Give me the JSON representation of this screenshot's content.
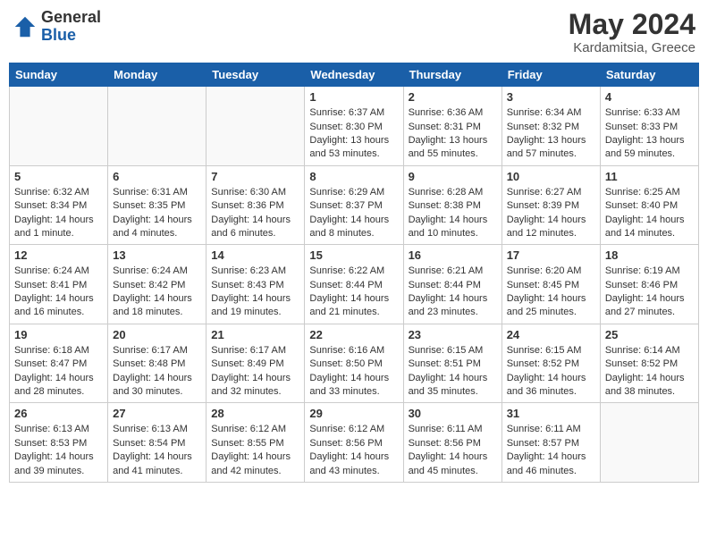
{
  "header": {
    "logo_general": "General",
    "logo_blue": "Blue",
    "title": "May 2024",
    "subtitle": "Kardamitsia, Greece"
  },
  "calendar": {
    "days_of_week": [
      "Sunday",
      "Monday",
      "Tuesday",
      "Wednesday",
      "Thursday",
      "Friday",
      "Saturday"
    ],
    "weeks": [
      [
        {
          "day": "",
          "info": ""
        },
        {
          "day": "",
          "info": ""
        },
        {
          "day": "",
          "info": ""
        },
        {
          "day": "1",
          "info": "Sunrise: 6:37 AM\nSunset: 8:30 PM\nDaylight: 13 hours\nand 53 minutes."
        },
        {
          "day": "2",
          "info": "Sunrise: 6:36 AM\nSunset: 8:31 PM\nDaylight: 13 hours\nand 55 minutes."
        },
        {
          "day": "3",
          "info": "Sunrise: 6:34 AM\nSunset: 8:32 PM\nDaylight: 13 hours\nand 57 minutes."
        },
        {
          "day": "4",
          "info": "Sunrise: 6:33 AM\nSunset: 8:33 PM\nDaylight: 13 hours\nand 59 minutes."
        }
      ],
      [
        {
          "day": "5",
          "info": "Sunrise: 6:32 AM\nSunset: 8:34 PM\nDaylight: 14 hours\nand 1 minute."
        },
        {
          "day": "6",
          "info": "Sunrise: 6:31 AM\nSunset: 8:35 PM\nDaylight: 14 hours\nand 4 minutes."
        },
        {
          "day": "7",
          "info": "Sunrise: 6:30 AM\nSunset: 8:36 PM\nDaylight: 14 hours\nand 6 minutes."
        },
        {
          "day": "8",
          "info": "Sunrise: 6:29 AM\nSunset: 8:37 PM\nDaylight: 14 hours\nand 8 minutes."
        },
        {
          "day": "9",
          "info": "Sunrise: 6:28 AM\nSunset: 8:38 PM\nDaylight: 14 hours\nand 10 minutes."
        },
        {
          "day": "10",
          "info": "Sunrise: 6:27 AM\nSunset: 8:39 PM\nDaylight: 14 hours\nand 12 minutes."
        },
        {
          "day": "11",
          "info": "Sunrise: 6:25 AM\nSunset: 8:40 PM\nDaylight: 14 hours\nand 14 minutes."
        }
      ],
      [
        {
          "day": "12",
          "info": "Sunrise: 6:24 AM\nSunset: 8:41 PM\nDaylight: 14 hours\nand 16 minutes."
        },
        {
          "day": "13",
          "info": "Sunrise: 6:24 AM\nSunset: 8:42 PM\nDaylight: 14 hours\nand 18 minutes."
        },
        {
          "day": "14",
          "info": "Sunrise: 6:23 AM\nSunset: 8:43 PM\nDaylight: 14 hours\nand 19 minutes."
        },
        {
          "day": "15",
          "info": "Sunrise: 6:22 AM\nSunset: 8:44 PM\nDaylight: 14 hours\nand 21 minutes."
        },
        {
          "day": "16",
          "info": "Sunrise: 6:21 AM\nSunset: 8:44 PM\nDaylight: 14 hours\nand 23 minutes."
        },
        {
          "day": "17",
          "info": "Sunrise: 6:20 AM\nSunset: 8:45 PM\nDaylight: 14 hours\nand 25 minutes."
        },
        {
          "day": "18",
          "info": "Sunrise: 6:19 AM\nSunset: 8:46 PM\nDaylight: 14 hours\nand 27 minutes."
        }
      ],
      [
        {
          "day": "19",
          "info": "Sunrise: 6:18 AM\nSunset: 8:47 PM\nDaylight: 14 hours\nand 28 minutes."
        },
        {
          "day": "20",
          "info": "Sunrise: 6:17 AM\nSunset: 8:48 PM\nDaylight: 14 hours\nand 30 minutes."
        },
        {
          "day": "21",
          "info": "Sunrise: 6:17 AM\nSunset: 8:49 PM\nDaylight: 14 hours\nand 32 minutes."
        },
        {
          "day": "22",
          "info": "Sunrise: 6:16 AM\nSunset: 8:50 PM\nDaylight: 14 hours\nand 33 minutes."
        },
        {
          "day": "23",
          "info": "Sunrise: 6:15 AM\nSunset: 8:51 PM\nDaylight: 14 hours\nand 35 minutes."
        },
        {
          "day": "24",
          "info": "Sunrise: 6:15 AM\nSunset: 8:52 PM\nDaylight: 14 hours\nand 36 minutes."
        },
        {
          "day": "25",
          "info": "Sunrise: 6:14 AM\nSunset: 8:52 PM\nDaylight: 14 hours\nand 38 minutes."
        }
      ],
      [
        {
          "day": "26",
          "info": "Sunrise: 6:13 AM\nSunset: 8:53 PM\nDaylight: 14 hours\nand 39 minutes."
        },
        {
          "day": "27",
          "info": "Sunrise: 6:13 AM\nSunset: 8:54 PM\nDaylight: 14 hours\nand 41 minutes."
        },
        {
          "day": "28",
          "info": "Sunrise: 6:12 AM\nSunset: 8:55 PM\nDaylight: 14 hours\nand 42 minutes."
        },
        {
          "day": "29",
          "info": "Sunrise: 6:12 AM\nSunset: 8:56 PM\nDaylight: 14 hours\nand 43 minutes."
        },
        {
          "day": "30",
          "info": "Sunrise: 6:11 AM\nSunset: 8:56 PM\nDaylight: 14 hours\nand 45 minutes."
        },
        {
          "day": "31",
          "info": "Sunrise: 6:11 AM\nSunset: 8:57 PM\nDaylight: 14 hours\nand 46 minutes."
        },
        {
          "day": "",
          "info": ""
        }
      ]
    ]
  }
}
